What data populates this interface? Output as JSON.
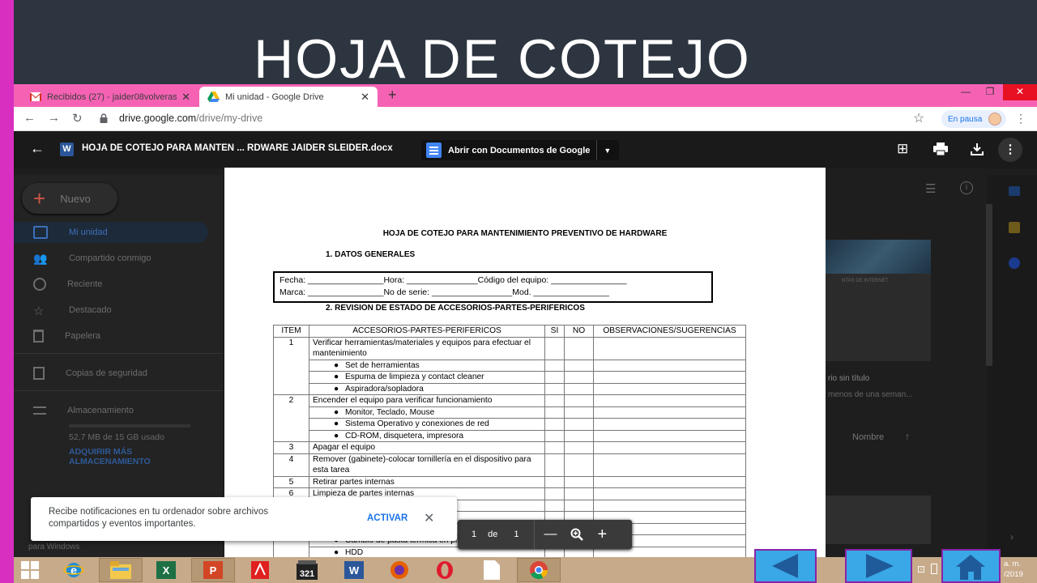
{
  "slide": {
    "title": "HOJA DE COTEJO"
  },
  "browser": {
    "tabs": [
      {
        "label": "Recibidos (27) - jaider08volveras",
        "close": "✕"
      },
      {
        "label": "Mi unidad - Google Drive",
        "close": "✕"
      }
    ],
    "new_tab": "+",
    "window_controls": {
      "minimize": "—",
      "restore": "❐",
      "close": "✕"
    },
    "url": {
      "host": "drive.google.com",
      "path": "/drive/my-drive"
    },
    "profile_status": "En pausa"
  },
  "drive": {
    "new_button": "Nuevo",
    "nav_items": [
      "Mi unidad",
      "Compartido conmigo",
      "Reciente",
      "Destacado",
      "Papelera",
      "Copias de seguridad",
      "Almacenamiento"
    ],
    "storage_used": "52,7 MB de 15 GB usado",
    "buy_storage": "ADQUIRIR MÁS ALMACENAMIENTO",
    "bg_file_name": "rio sin título",
    "bg_file_date": "menos de una seman...",
    "bg_sort_label": "Nombre",
    "bg_card_caption": "NTAS DE INTERNET"
  },
  "viewer": {
    "filename": "HOJA DE COTEJO PARA MANTEN ... RDWARE JAIDER SLEIDER.docx",
    "open_with": "Abrir con Documentos de Google",
    "page_current": "1",
    "page_of": "de",
    "page_total": "1"
  },
  "document": {
    "title": "HOJA DE COTEJO PARA MANTENIMIENTO PREVENTIVO DE HARDWARE",
    "section1": "1.   DATOS GENERALES",
    "form_line1": "Fecha: ________________Hora: _______________Código del equipo: ________________",
    "form_line2": "Marca: ________________No de serie: _________________Mod. ________________",
    "section2": "2.   REVISION DE ESTADO DE ACCESORIOS-PARTES-PERIFERICOS",
    "headers": [
      "ITEM",
      "ACCESORIOS-PARTES-PERIFERICOS",
      "SI",
      "NO",
      "OBSERVACIONES/SUGERENCIAS"
    ],
    "rows": {
      "r1": "Verificar herramientas/materiales y equipos para efectuar el mantenimiento",
      "r1a": "Set de herramientas",
      "r1b": "Espuma de limpieza y contact cleaner",
      "r1c": "Aspiradora/sopladora",
      "r2": "Encender el equipo para verificar funcionamiento",
      "r2a": "Monitor, Teclado, Mouse",
      "r2b": "Sistema Operativo y conexiones de red",
      "r2c": "CD-ROM, disquetera, impresora",
      "r3": "Apagar el equipo",
      "r4": "Remover (gabinete)-colocar tornillería en el dispositivo para esta tarea",
      "r5": "Retirar partes internas",
      "r6": "Limpieza de partes internas",
      "r6x": "Cambio de pasta térmica en procesador",
      "r6y": "HDD"
    },
    "item_numbers": [
      "1",
      "2",
      "3",
      "4",
      "5",
      "6"
    ]
  },
  "toast": {
    "message": "Recibe notificaciones en tu ordenador sobre archivos compartidos y eventos importantes.",
    "action": "ACTIVAR",
    "close": "✕",
    "behind_text": "para Windows"
  },
  "taskbar": {
    "clock_time": "a. m.",
    "clock_date": "/2019"
  }
}
